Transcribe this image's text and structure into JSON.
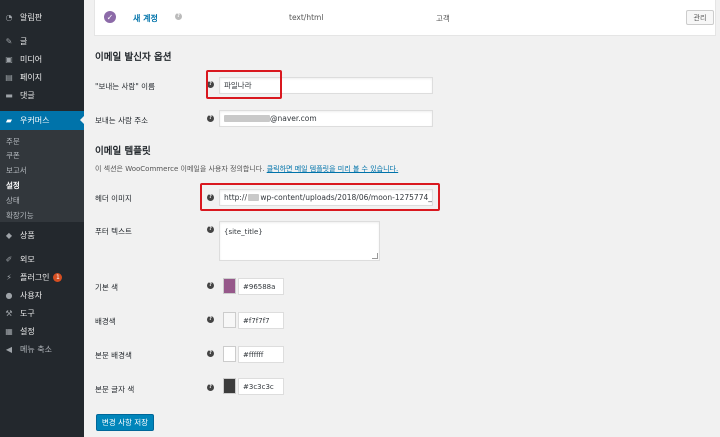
{
  "sidebar": {
    "items": [
      {
        "label": "알림판",
        "icon": "dashboard-icon"
      },
      {
        "label": "글",
        "icon": "pin-icon"
      },
      {
        "label": "미디어",
        "icon": "media-icon"
      },
      {
        "label": "페이지",
        "icon": "page-icon"
      },
      {
        "label": "댓글",
        "icon": "comments-icon"
      },
      {
        "label": "우커머스",
        "icon": "woocommerce-icon"
      },
      {
        "label": "상품",
        "icon": "products-icon"
      },
      {
        "label": "외모",
        "icon": "appearance-icon"
      },
      {
        "label": "플러그인",
        "icon": "plugins-icon",
        "badge": "1"
      },
      {
        "label": "사용자",
        "icon": "users-icon"
      },
      {
        "label": "도구",
        "icon": "tools-icon"
      },
      {
        "label": "설정",
        "icon": "settings-icon"
      },
      {
        "label": "메뉴 축소",
        "icon": "collapse-icon"
      }
    ],
    "submenu": [
      "주문",
      "쿠폰",
      "보고서",
      "설정",
      "상태",
      "확장기능"
    ],
    "active_submenu": "설정"
  },
  "email_row": {
    "name": "새 계정",
    "content_type": "text/html",
    "recipient": "고객",
    "manage_label": "관리"
  },
  "sender_section": {
    "title": "이메일 발신자 옵션",
    "from_name_label": "\"보내는 사람\" 이름",
    "from_name_value": "파일나라",
    "from_address_label": "보내는 사람 주소",
    "from_address_value": "@naver.com"
  },
  "template_section": {
    "title": "이메일 템플릿",
    "description_prefix": "이 섹션은 WooCommerce 이메일을 사용자 정의합니다.",
    "description_link": "클릭하면 메일 템플릿을 미리 볼 수 있습니다.",
    "header_image_label": "헤더 이미지",
    "header_image_prefix": "http://",
    "header_image_value": "wp-content/uploads/2018/06/moon-1275774_",
    "footer_text_label": "푸터 텍스트",
    "footer_text_value": "{site_title}",
    "colors": [
      {
        "label": "기본 색",
        "hex": "#96588a"
      },
      {
        "label": "배경색",
        "hex": "#f7f7f7"
      },
      {
        "label": "본문 배경색",
        "hex": "#ffffff"
      },
      {
        "label": "본문 글자 색",
        "hex": "#3c3c3c"
      }
    ]
  },
  "save_button_label": "변경 사항 저장",
  "colors": {
    "sidebar_bg": "#23282d",
    "active_menu": "#0073aa",
    "highlight_box": "#d9181f",
    "primary_button": "#0085ba"
  }
}
